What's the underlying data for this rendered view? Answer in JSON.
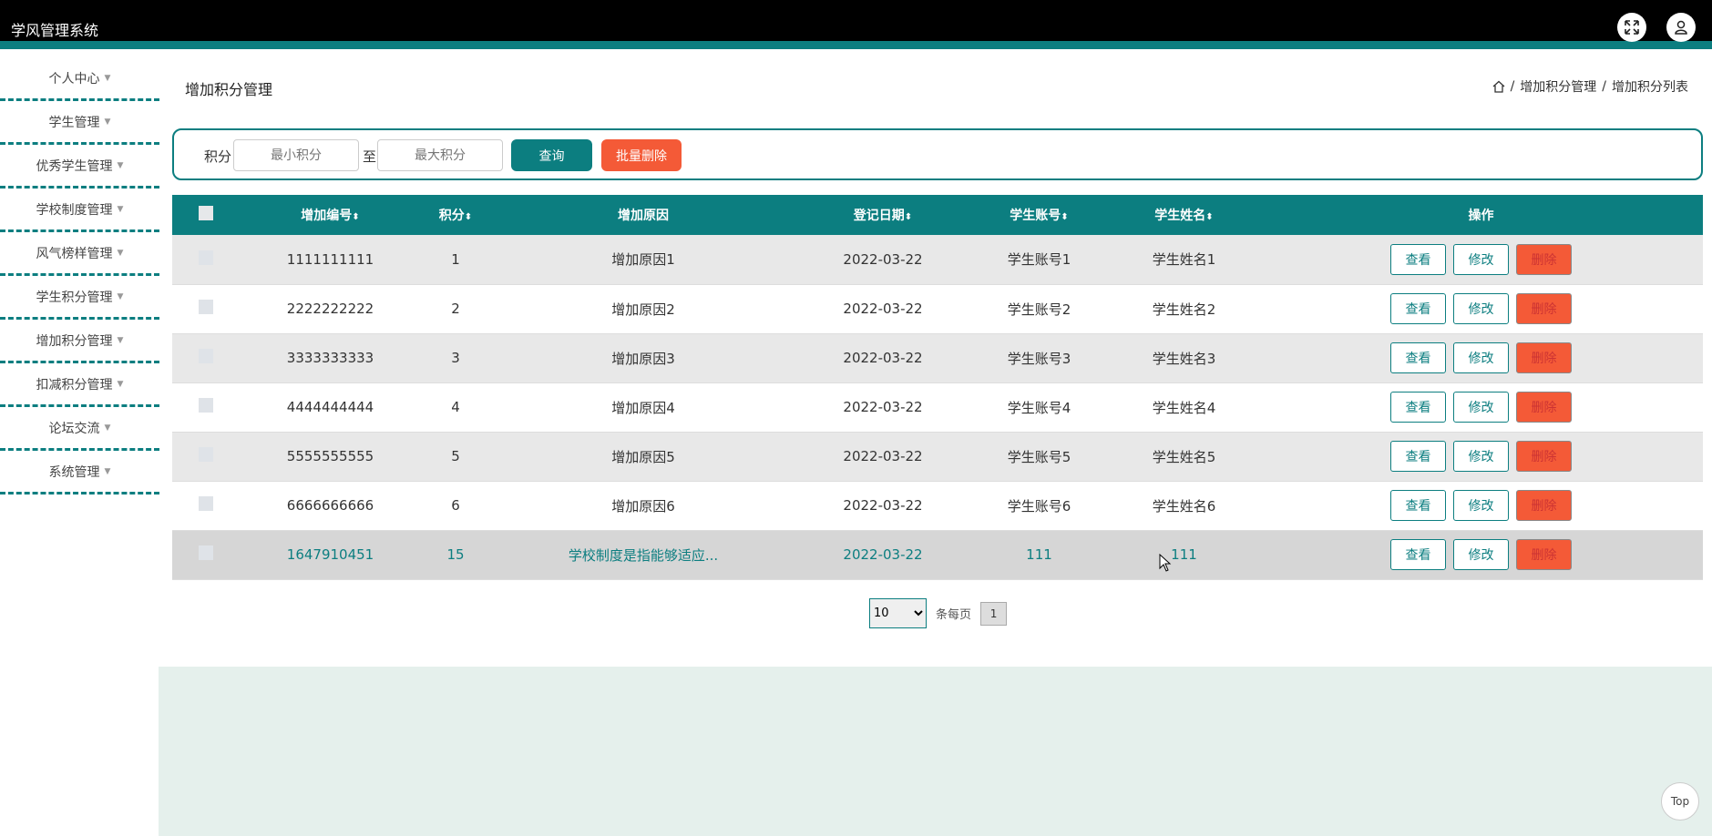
{
  "app_title": "学风管理系统",
  "sidebar": {
    "items": [
      {
        "label": "个人中心"
      },
      {
        "label": "学生管理"
      },
      {
        "label": "优秀学生管理"
      },
      {
        "label": "学校制度管理"
      },
      {
        "label": "风气榜样管理"
      },
      {
        "label": "学生积分管理"
      },
      {
        "label": "增加积分管理"
      },
      {
        "label": "扣减积分管理"
      },
      {
        "label": "论坛交流"
      },
      {
        "label": "系统管理"
      }
    ]
  },
  "page_title": "增加积分管理",
  "breadcrumb": {
    "sep": "/",
    "level1": "增加积分管理",
    "level2": "增加积分列表"
  },
  "search": {
    "label": "积分",
    "min_placeholder": "最小积分",
    "to_label": "至",
    "max_placeholder": "最大积分",
    "query_label": "查询",
    "batch_delete_label": "批量删除"
  },
  "table": {
    "headers": {
      "id": "增加编号",
      "score": "积分",
      "reason": "增加原因",
      "date": "登记日期",
      "account": "学生账号",
      "name": "学生姓名",
      "ops": "操作"
    },
    "rows": [
      {
        "id": "1111111111",
        "score": "1",
        "reason": "增加原因1",
        "date": "2022-03-22",
        "account": "学生账号1",
        "name": "学生姓名1"
      },
      {
        "id": "2222222222",
        "score": "2",
        "reason": "增加原因2",
        "date": "2022-03-22",
        "account": "学生账号2",
        "name": "学生姓名2"
      },
      {
        "id": "3333333333",
        "score": "3",
        "reason": "增加原因3",
        "date": "2022-03-22",
        "account": "学生账号3",
        "name": "学生姓名3"
      },
      {
        "id": "4444444444",
        "score": "4",
        "reason": "增加原因4",
        "date": "2022-03-22",
        "account": "学生账号4",
        "name": "学生姓名4"
      },
      {
        "id": "5555555555",
        "score": "5",
        "reason": "增加原因5",
        "date": "2022-03-22",
        "account": "学生账号5",
        "name": "学生姓名5"
      },
      {
        "id": "6666666666",
        "score": "6",
        "reason": "增加原因6",
        "date": "2022-03-22",
        "account": "学生账号6",
        "name": "学生姓名6"
      },
      {
        "id": "1647910451",
        "score": "15",
        "reason": "学校制度是指能够适应...",
        "date": "2022-03-22",
        "account": "111",
        "name": "111"
      }
    ],
    "ops": {
      "view": "查看",
      "edit": "修改",
      "delete": "删除"
    }
  },
  "pager": {
    "page_size": "10",
    "per_page_label": "条每页",
    "current_page": "1"
  },
  "top_button": "Top"
}
